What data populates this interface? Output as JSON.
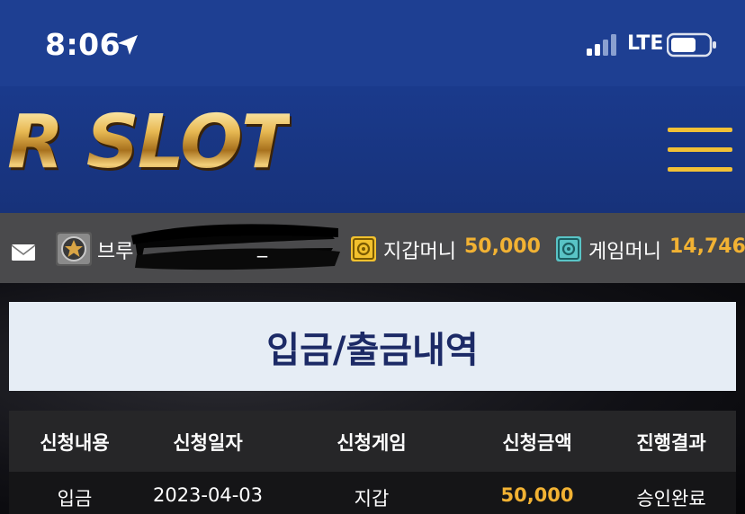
{
  "status_bar": {
    "time": "8:06",
    "network": "LTE"
  },
  "header": {
    "logo_text": "R SLOT",
    "menu_icon": "hamburger-menu-icon"
  },
  "user_bar": {
    "username": "브루",
    "username_tail": "_",
    "wallet_label": "지갑머니",
    "wallet_amount": "50,000",
    "game_label": "게임머니",
    "game_amount": "14,746"
  },
  "page": {
    "title": "입금/출금내역"
  },
  "table": {
    "headers": [
      "신청내용",
      "신청일자",
      "신청게임",
      "신청금액",
      "진행결과"
    ],
    "rows": [
      [
        "입금",
        "2023-04-03",
        "지갑",
        "50,000",
        "승인완료"
      ]
    ]
  },
  "colors": {
    "accent_gold": "#f2b233",
    "header_blue": "#1e3f92",
    "title_navy": "#1c2a66"
  }
}
